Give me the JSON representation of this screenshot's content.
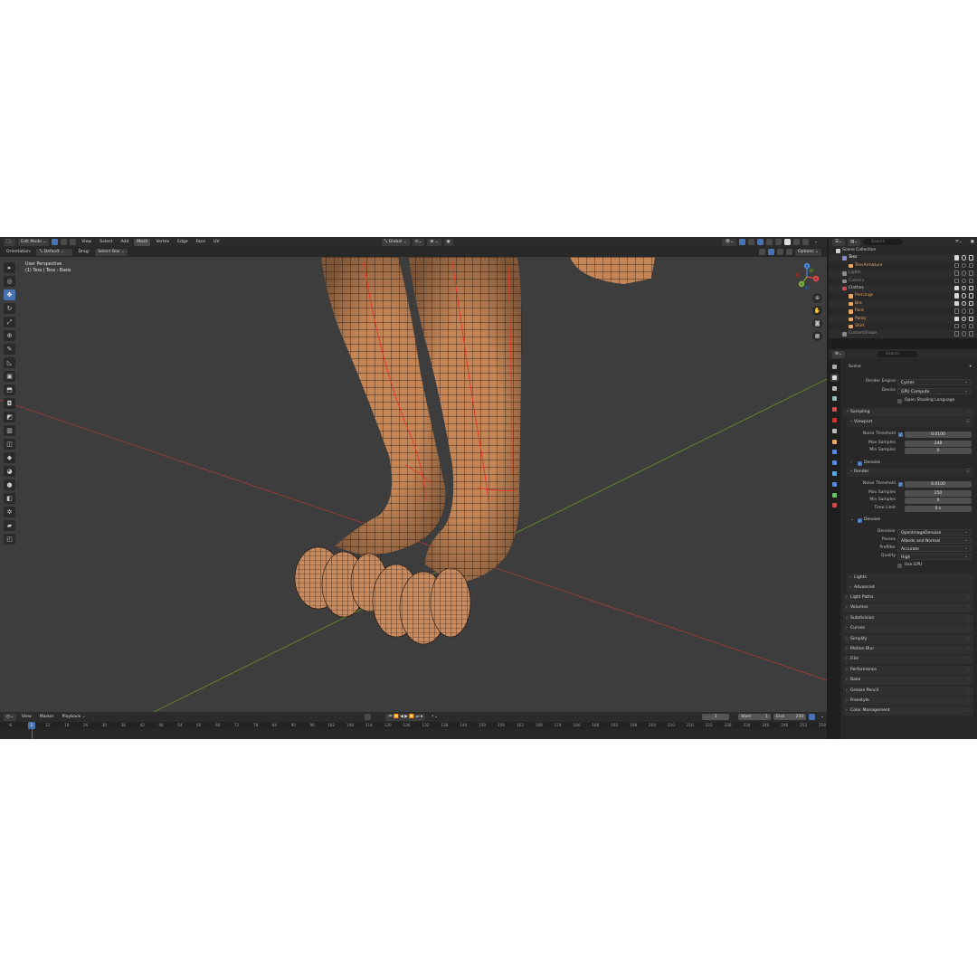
{
  "header": {
    "mode": "Edit Mode",
    "menus": [
      "View",
      "Select",
      "Add",
      "Mesh",
      "Vertex",
      "Edge",
      "Face",
      "UV"
    ],
    "transform": "Global",
    "options": "Options"
  },
  "tool_header": {
    "orientation_label": "Orientation:",
    "orientation_value": "Default",
    "drag_label": "Drag:",
    "drag_value": "Select Box"
  },
  "viewport": {
    "view_name": "User Perspective",
    "object_info": "(1) Tess | Tess : Basis",
    "gizmo_axes": {
      "x": "X",
      "y": "Y",
      "z": "Z"
    }
  },
  "timeline": {
    "menus": [
      "View",
      "Marker",
      "Playback"
    ],
    "current_frame": "1",
    "start_label": "Start",
    "start_value": "1",
    "end_label": "End",
    "end_value": "250",
    "ticks": [
      "-6",
      "6",
      "12",
      "18",
      "26",
      "30",
      "36",
      "42",
      "48",
      "54",
      "60",
      "66",
      "72",
      "78",
      "84",
      "90",
      "96",
      "102",
      "108",
      "114",
      "120",
      "126",
      "132",
      "138",
      "144",
      "150",
      "156",
      "162",
      "168",
      "174",
      "180",
      "186",
      "192",
      "198",
      "204",
      "210",
      "216",
      "222",
      "228",
      "234",
      "240",
      "246",
      "252",
      "258"
    ]
  },
  "outliner": {
    "search_placeholder": "Search",
    "rows": [
      {
        "name": "Scene Collection",
        "indent": 0,
        "color": "#cfcfcf",
        "dim": false
      },
      {
        "name": "Tess",
        "indent": 1,
        "color": "#ffffff",
        "dim": false
      },
      {
        "name": "TessArmature",
        "indent": 2,
        "color": "#e9a86b",
        "dim": true
      },
      {
        "name": "Lights",
        "indent": 1,
        "color": "#8a8a8a",
        "dim": true
      },
      {
        "name": "Camera",
        "indent": 1,
        "color": "#8a8a8a",
        "dim": true
      },
      {
        "name": "Clothes",
        "indent": 1,
        "color": "#d0d0d0",
        "dim": false
      },
      {
        "name": "Piercings",
        "indent": 2,
        "color": "#e9a86b",
        "dim": false
      },
      {
        "name": "Bra",
        "indent": 2,
        "color": "#e9a86b",
        "dim": false
      },
      {
        "name": "Pant",
        "indent": 2,
        "color": "#e9a86b",
        "dim": true
      },
      {
        "name": "Panty",
        "indent": 2,
        "color": "#e9a86b",
        "dim": false
      },
      {
        "name": "Shirt",
        "indent": 2,
        "color": "#e9a86b",
        "dim": true
      },
      {
        "name": "CustomShape",
        "indent": 1,
        "color": "#8a8a8a",
        "dim": true
      }
    ]
  },
  "properties": {
    "search_placeholder": "Search",
    "context": "Scene",
    "render_engine_label": "Render Engine",
    "render_engine": "Cycles",
    "device_label": "Device",
    "device": "GPU Compute",
    "osl_label": "Open Shading Language",
    "sampling": "Sampling",
    "viewport": "Viewport",
    "noise_threshold_label": "Noise Threshold",
    "vp_noise_threshold": "0.0100",
    "max_samples_label": "Max Samples",
    "vp_max_samples": "248",
    "min_samples_label": "Min Samples",
    "vp_min_samples": "0",
    "denoise": "Denoise",
    "render": "Render",
    "r_noise_threshold": "0.0100",
    "r_max_samples": "250",
    "r_min_samples": "0",
    "time_limit_label": "Time Limit",
    "r_time_limit": "0 s",
    "denoiser_label": "Denoiser",
    "denoiser": "OpenImageDenoise",
    "passes_label": "Passes",
    "passes": "Albedo and Normal",
    "prefilter_label": "Prefilter",
    "prefilter": "Accurate",
    "quality_label": "Quality",
    "quality": "High",
    "use_gpu_label": "Use GPU",
    "lights": "Lights",
    "advanced": "Advanced",
    "panels": [
      "Light Paths",
      "Volumes",
      "Subdivision",
      "Curves",
      "Simplify",
      "Motion Blur",
      "Film",
      "Performance",
      "Bake",
      "Grease Pencil",
      "Freestyle",
      "Color Management"
    ]
  },
  "colors": {
    "accent": "#4772b3",
    "skin": "#c98a5e",
    "seam": "#e03a2a",
    "grid_x": "#9b3b3b",
    "grid_y": "#6a8a2a"
  }
}
